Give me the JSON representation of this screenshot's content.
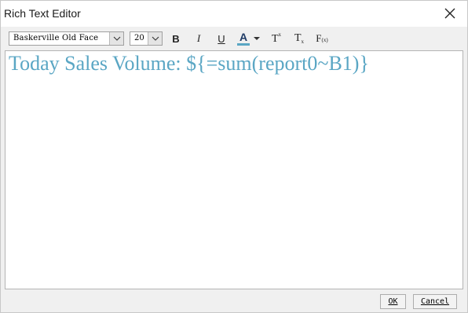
{
  "window": {
    "title": "Rich Text Editor"
  },
  "toolbar": {
    "font_family": "Baskerville Old Face",
    "font_size": "20",
    "bold_label": "B",
    "italic_label": "I",
    "underline_label": "U",
    "font_color_label": "A",
    "font_color": "#5aa6c4",
    "superscript_label": "T",
    "superscript_mark": "x",
    "subscript_label": "T",
    "subscript_mark": "x",
    "formula_label": "F",
    "formula_mark": "(x)"
  },
  "editor": {
    "content": "Today Sales Volume: ${=sum(report0~B1)}",
    "text_color": "#5aa6c4"
  },
  "footer": {
    "ok_label": "OK",
    "cancel_label": "Cancel"
  },
  "icons": {
    "close": "close-icon",
    "dropdown": "chevron-down-icon"
  }
}
